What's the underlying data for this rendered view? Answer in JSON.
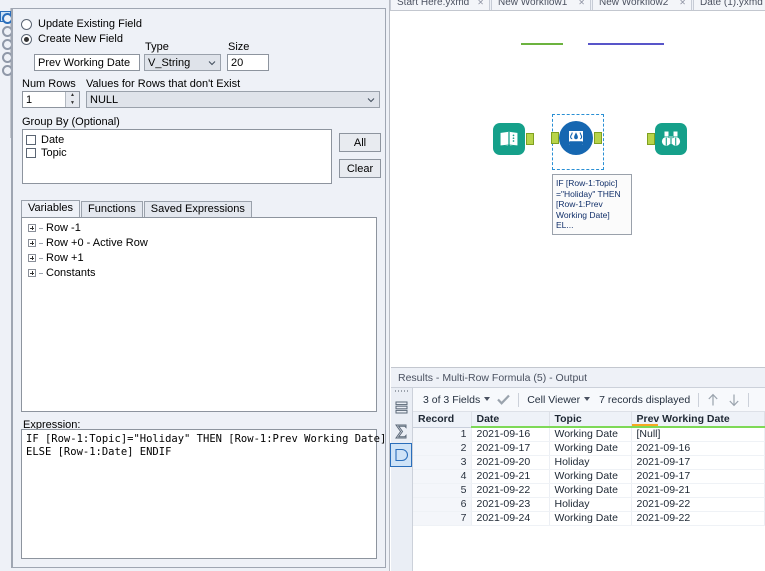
{
  "window": {
    "workflow_tabs": [
      {
        "label": "Start Here.yxmd",
        "close": "✕"
      },
      {
        "label": "New Workflow1",
        "close": "✕"
      },
      {
        "label": "New Workflow2",
        "close": "✕"
      },
      {
        "label": "Date (1).yxmd",
        "close": "✕"
      }
    ]
  },
  "config": {
    "update_existing_label": "Update Existing Field",
    "create_new_label": "Create New  Field",
    "new_field_name": "Prev Working Date",
    "type_label": "Type",
    "type_value": "V_String",
    "size_label": "Size",
    "size_value": "20",
    "num_rows_label": "Num Rows",
    "num_rows_value": "1",
    "values_rows_label": "Values for Rows that don't Exist",
    "values_rows_value": "NULL",
    "group_by_label": "Group By (Optional)",
    "group_by_fields": [
      {
        "label": "Date",
        "checked": false
      },
      {
        "label": "Topic",
        "checked": false
      }
    ],
    "all_button": "All",
    "clear_button": "Clear",
    "tabs": [
      {
        "label": "Variables",
        "active": true
      },
      {
        "label": "Functions",
        "active": false
      },
      {
        "label": "Saved Expressions",
        "active": false
      }
    ],
    "variables_tree": [
      "Row -1",
      "Row +0 - Active Row",
      "Row +1",
      "Constants"
    ],
    "expression_label": "Expression:",
    "expression_value": "IF [Row-1:Topic]=\"Holiday\" THEN [Row-1:Prev Working Date]\nELSE [Row-1:Date] ENDIF"
  },
  "canvas": {
    "input_node_name": "input-data-tool",
    "formula_node_name": "multi-row-formula-tool",
    "browse_node_name": "browse-tool",
    "annotation": "IF [Row-1:Topic]\n=\"Holiday\" THEN\n[Row-1:Prev\nWorking Date]\nEL..."
  },
  "results": {
    "title": "Results - Multi-Row Formula (5) - Output",
    "fields_selector": "3 of 3 Fields",
    "viewer_selector": "Cell Viewer",
    "records_displayed": "7 records displayed",
    "columns": [
      "Record",
      "Date",
      "Topic",
      "Prev Working Date"
    ],
    "rows": [
      {
        "record": "1",
        "date": "2021-09-16",
        "topic": "Working Date",
        "prev": "[Null]",
        "is_null": true
      },
      {
        "record": "2",
        "date": "2021-09-17",
        "topic": "Working Date",
        "prev": "2021-09-16",
        "is_null": false
      },
      {
        "record": "3",
        "date": "2021-09-20",
        "topic": "Holiday",
        "prev": "2021-09-17",
        "is_null": false
      },
      {
        "record": "4",
        "date": "2021-09-21",
        "topic": "Working Date",
        "prev": "2021-09-17",
        "is_null": false
      },
      {
        "record": "5",
        "date": "2021-09-22",
        "topic": "Working Date",
        "prev": "2021-09-21",
        "is_null": false
      },
      {
        "record": "6",
        "date": "2021-09-23",
        "topic": "Holiday",
        "prev": "2021-09-22",
        "is_null": false
      },
      {
        "record": "7",
        "date": "2021-09-24",
        "topic": "Working Date",
        "prev": "2021-09-22",
        "is_null": false
      }
    ]
  },
  "colors": {
    "alteryx_teal": "#15a08a",
    "alteryx_blue": "#1667b1",
    "panel_bg": "#eef1f7",
    "header_underline_green": "#7ed957",
    "header_underline_orange": "#f7a823",
    "selection_blue": "#2a8fd4"
  }
}
